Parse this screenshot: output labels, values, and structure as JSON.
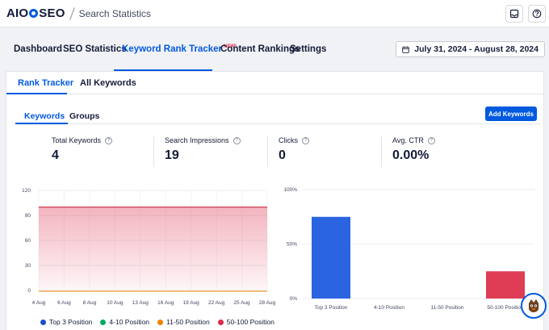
{
  "header": {
    "logo_text_left": "AIO",
    "logo_text_right": "SEO",
    "breadcrumb": "Search Statistics",
    "icons": [
      "inbox-icon",
      "help-icon"
    ]
  },
  "nav": {
    "tabs": [
      {
        "label": "Dashboard"
      },
      {
        "label": "SEO Statistics"
      },
      {
        "label": "Keyword Rank Tracker",
        "badge": "NEW!",
        "active": true
      },
      {
        "label": "Content Rankings"
      },
      {
        "label": "Settings"
      }
    ],
    "date_range": "July 31, 2024 - August 28, 2024"
  },
  "subtabs": [
    {
      "label": "Rank Tracker",
      "active": true
    },
    {
      "label": "All Keywords"
    }
  ],
  "keyword_tabs": [
    {
      "label": "Keywords",
      "active": true
    },
    {
      "label": "Groups"
    }
  ],
  "add_button": "Add Keywords",
  "stats": [
    {
      "label": "Total Keywords",
      "value": "4"
    },
    {
      "label": "Search Impressions",
      "value": "19"
    },
    {
      "label": "Clicks",
      "value": "0"
    },
    {
      "label": "Avg. CTR",
      "value": "0.00%"
    }
  ],
  "colors": {
    "accent": "#005ae0",
    "top3": "#2a64e0",
    "pos4_10": "#00aa63",
    "pos11_50": "#f18200",
    "pos50_100": "#df2a4a"
  },
  "legend": [
    {
      "label": "Top 3 Position",
      "color": "#1f4fc9"
    },
    {
      "label": "4-10 Position",
      "color": "#00aa63"
    },
    {
      "label": "11-50 Position",
      "color": "#f18200"
    },
    {
      "label": "50-100 Position",
      "color": "#df2a4a"
    }
  ],
  "chart_data": [
    {
      "type": "area",
      "x": [
        "4 Aug",
        "6 Aug",
        "8 Aug",
        "10 Aug",
        "13 Aug",
        "16 Aug",
        "19 Aug",
        "22 Aug",
        "25 Aug",
        "28 Aug"
      ],
      "ylim": [
        0,
        120
      ],
      "yticks": [
        "0",
        "30",
        "60",
        "90",
        "120"
      ],
      "series": [
        {
          "name": "50-100 Position",
          "color": "#df2a4a",
          "values": [
            100,
            100,
            100,
            100,
            100,
            100,
            100,
            100,
            100,
            100
          ]
        },
        {
          "name": "11-50 Position",
          "color": "#f18200",
          "values": [
            0,
            0,
            0,
            0,
            0,
            0,
            0,
            0,
            0,
            0
          ]
        }
      ],
      "grid": true
    },
    {
      "type": "bar",
      "categories": [
        "Top 3 Position",
        "4-10 Position",
        "11-50 Position",
        "50-100 Position"
      ],
      "values": [
        75,
        0,
        0,
        25
      ],
      "colors": [
        "#2a64e0",
        "#00aa63",
        "#f18200",
        "#df3c56"
      ],
      "ylim": [
        0,
        100
      ],
      "yticks": [
        "0%",
        "50%",
        "100%"
      ],
      "grid": true
    }
  ]
}
